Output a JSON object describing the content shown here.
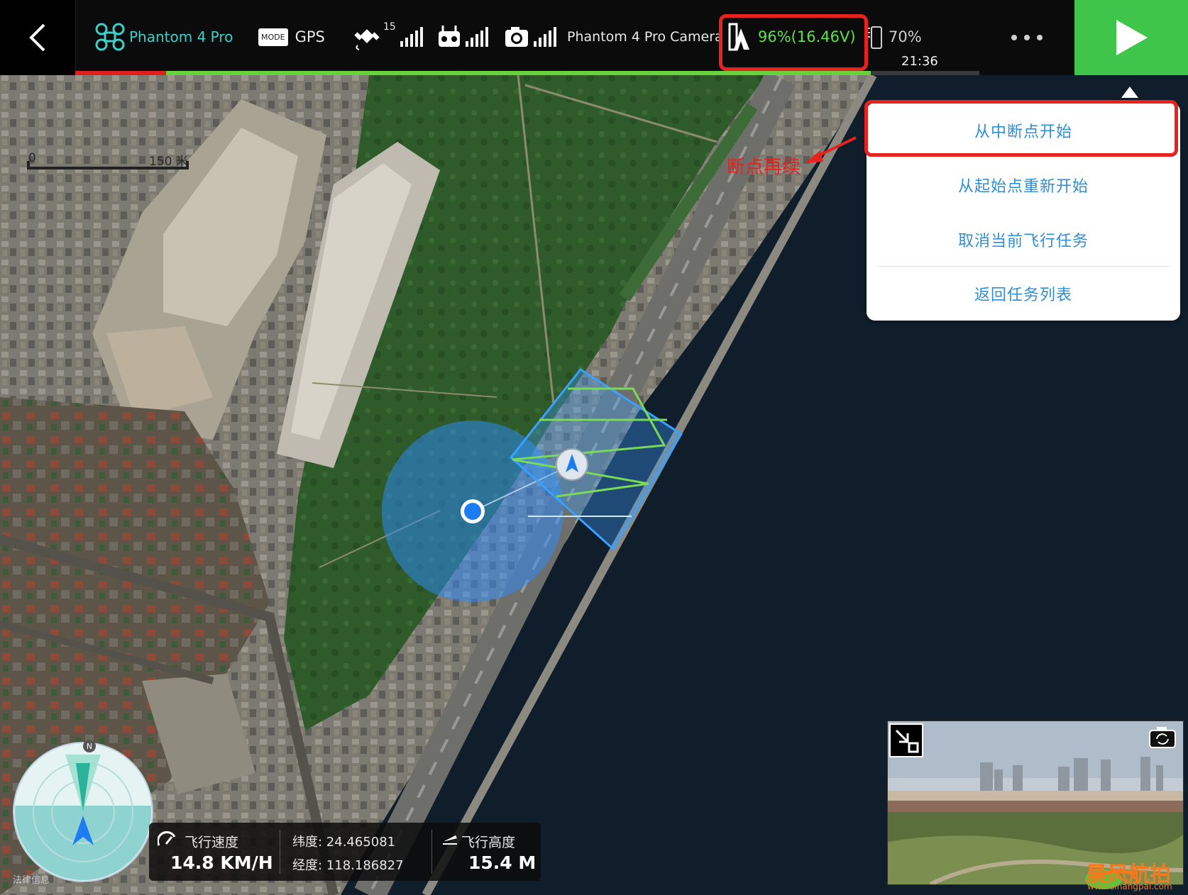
{
  "topbar": {
    "aircraft_name": "Phantom 4 Pro",
    "mode_badge": "MODE",
    "mode_value": "GPS",
    "satellite_count": "15",
    "camera_name": "Phantom 4 Pro Camera",
    "aircraft_battery": "96%(16.46V)",
    "device_battery": "70%",
    "flight_time": "21:36",
    "mission_progress_fraction": 0.88
  },
  "scale_bar": {
    "start_label": "0",
    "end_label": "150 米"
  },
  "popup_menu": {
    "items": [
      "从中断点开始",
      "从起始点重新开始",
      "取消当前飞行任务",
      "返回任务列表"
    ]
  },
  "annotation": {
    "label": "断点再续"
  },
  "telemetry": {
    "speed_label": "飞行速度",
    "speed_value": "14.8 KM/H",
    "lat_label": "纬度: 24.465081",
    "lng_label": "经度: 118.186827",
    "altitude_label": "飞行高度",
    "altitude_value": "15.4 M"
  },
  "compass": {
    "north_label": "N"
  },
  "map": {
    "attribution": "法律信息"
  },
  "watermark": {
    "brand": "晨风航拍",
    "url": "www.sinangpai.com"
  },
  "colors": {
    "accent_green": "#3fc64a",
    "battery_green": "#5de04a",
    "menu_blue": "#2e8fd6",
    "highlight_red": "#e8221f",
    "water": "#101d2b"
  }
}
